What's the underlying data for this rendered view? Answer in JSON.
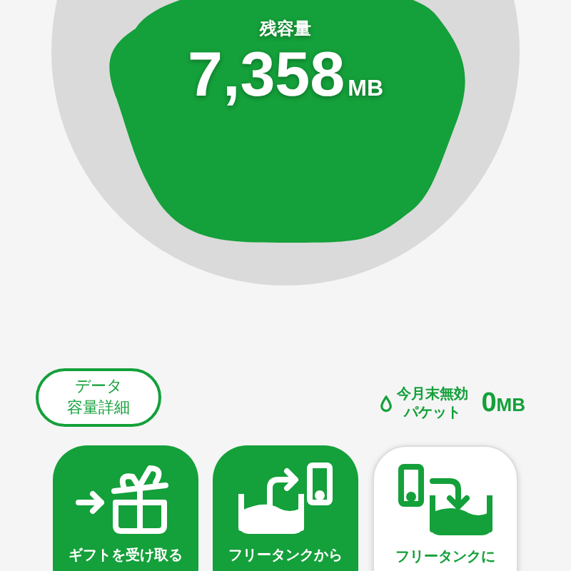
{
  "gauge": {
    "label": "残容量",
    "value": "7,358",
    "unit": "MB"
  },
  "details_button": {
    "lines": [
      "データ",
      "容量詳細"
    ]
  },
  "expiring": {
    "lines": [
      "今月末無効",
      "パケット"
    ],
    "value": "0",
    "unit": "MB"
  },
  "actions": [
    {
      "kind": "filled",
      "label": "ギフトを受け取る"
    },
    {
      "kind": "filled",
      "label": "フリータンクから"
    },
    {
      "kind": "outlined",
      "label": "フリータンクに"
    }
  ]
}
